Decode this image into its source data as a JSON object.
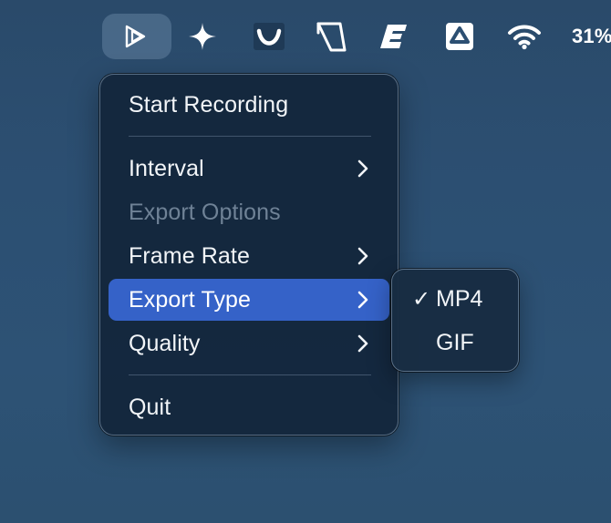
{
  "menubar": {
    "battery_percent": "31%",
    "icons": [
      "recorder-play-icon",
      "sparkle-icon",
      "curve-smile-icon",
      "window-shape-icon",
      "bold-e-icon",
      "drive-triangle-icon",
      "wifi-icon"
    ]
  },
  "menu": {
    "start_recording": "Start Recording",
    "interval": "Interval",
    "export_options": "Export Options",
    "frame_rate": "Frame Rate",
    "export_type": "Export Type",
    "quality": "Quality",
    "quit": "Quit"
  },
  "submenu": {
    "items": [
      {
        "label": "MP4",
        "checked": true,
        "check_glyph": "✓"
      },
      {
        "label": "GIF",
        "checked": false,
        "check_glyph": ""
      }
    ]
  },
  "colors": {
    "highlight": "#3562c8",
    "menu_bg": "#14263c",
    "disabled_text": "#6f8296"
  }
}
